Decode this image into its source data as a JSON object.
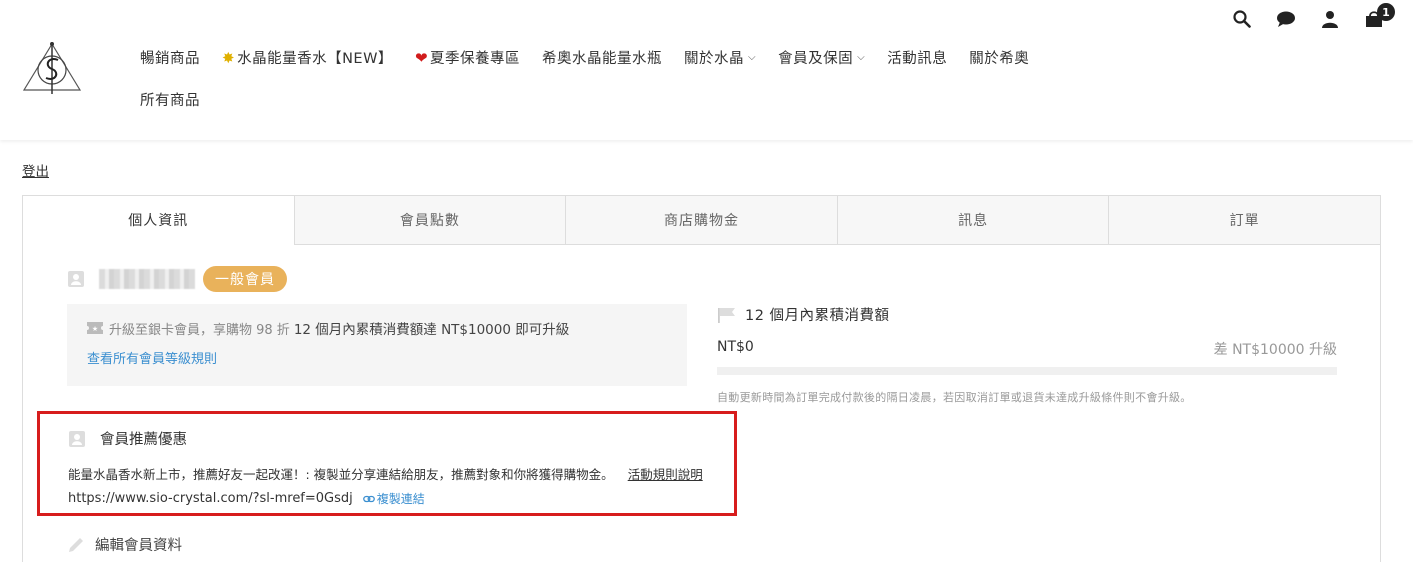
{
  "header": {
    "nav_row1": [
      {
        "label": "暢銷商品",
        "prefix": ""
      },
      {
        "label": "水晶能量香水【NEW】",
        "prefix": "✴"
      },
      {
        "label": "夏季保養專區",
        "prefix": "❤"
      },
      {
        "label": "希奧水晶能量水瓶",
        "prefix": ""
      },
      {
        "label": "關於水晶",
        "prefix": "",
        "dropdown": true
      },
      {
        "label": "會員及保固",
        "prefix": "",
        "dropdown": true
      },
      {
        "label": "活動訊息",
        "prefix": ""
      },
      {
        "label": "關於希奧",
        "prefix": ""
      }
    ],
    "nav_row2": [
      {
        "label": "所有商品"
      }
    ],
    "cart_count": "1",
    "icons": [
      "search-icon",
      "chat-icon",
      "user-icon",
      "cart-icon"
    ]
  },
  "logout_label": "登出",
  "tabs": [
    "個人資訊",
    "會員點數",
    "商店購物金",
    "訊息",
    "訂單"
  ],
  "member": {
    "level_badge": "一般會員"
  },
  "upgrade": {
    "text_gray": "升級至銀卡會員，享購物 98 折",
    "text_dark": "12 個月內累積消費額達 NT$10000 即可升級",
    "rules_link": "查看所有會員等級規則"
  },
  "spend": {
    "title": "12 個月內累積消費額",
    "current": "NT$0",
    "remaining": "差 NT$10000 升級",
    "progress": 0,
    "note": "自動更新時間為訂單完成付款後的隔日凌晨，若因取消訂單或退貨未達成升級條件則不會升級。"
  },
  "referral": {
    "title": "會員推薦優惠",
    "text": "能量水晶香水新上市，推薦好友一起改運！: 複製並分享連結給朋友，推薦對象和你將獲得購物金。",
    "rules_link": "活動規則說明",
    "url": "https://www.sio-crystal.com/?sl-mref=0Gsdj",
    "copy_label": "複製連結"
  },
  "edit_label": "編輯會員資料",
  "colors": {
    "badge": "#e9b25b",
    "link": "#3b8fd0",
    "highlight_border": "#d71d1d"
  }
}
